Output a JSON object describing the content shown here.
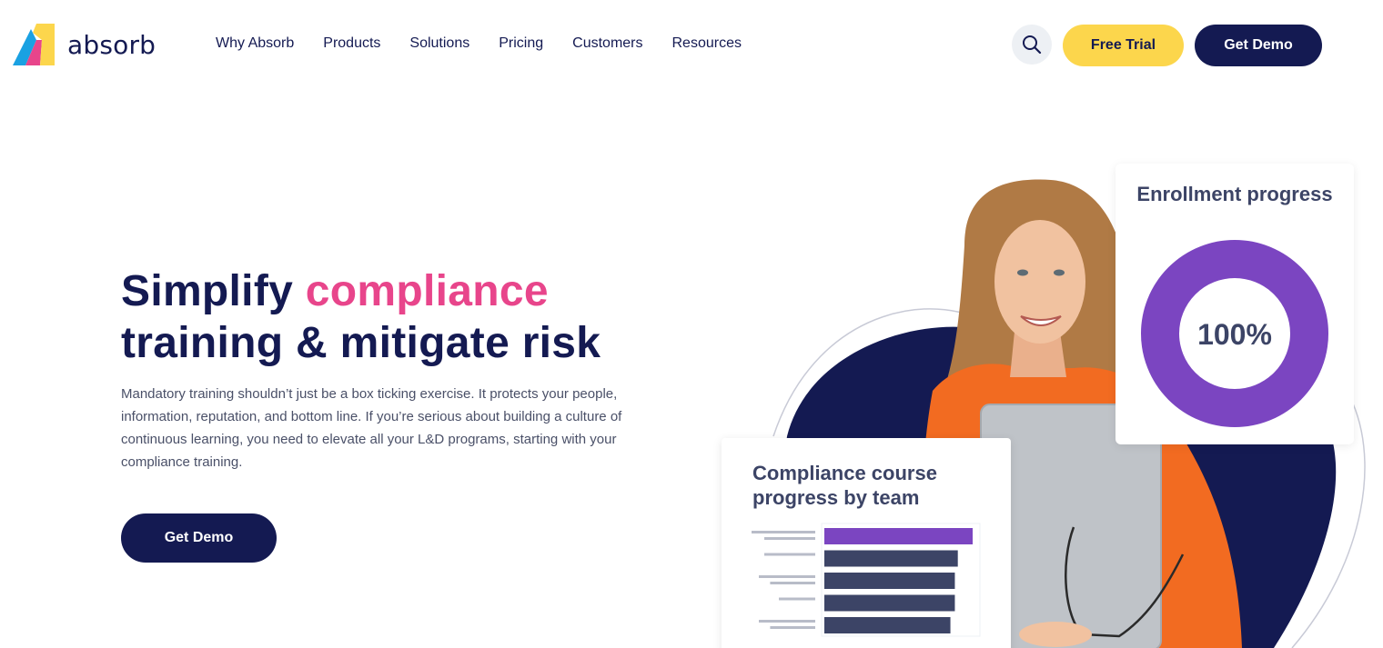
{
  "brand": {
    "name": "absorb",
    "colors": {
      "navy": "#141a52",
      "pink": "#e8458b",
      "yellow": "#fcd64c",
      "purple": "#7b45c1",
      "blue": "#1aa1e2"
    }
  },
  "nav": {
    "items": [
      {
        "label": "Why Absorb"
      },
      {
        "label": "Products"
      },
      {
        "label": "Solutions"
      },
      {
        "label": "Pricing"
      },
      {
        "label": "Customers"
      },
      {
        "label": "Resources"
      }
    ],
    "search_icon": "search-icon",
    "free_trial_label": "Free Trial",
    "get_demo_label": "Get Demo"
  },
  "hero": {
    "title_part1": "Simplify ",
    "title_accent": "compliance",
    "title_part2": "training & mitigate risk",
    "description": "Mandatory training shouldn’t just be a box ticking exercise. It protects your people, information, reputation, and bottom line. If you’re serious about building a culture of continuous learning, you need to elevate all your L&D programs, starting with your compliance training.",
    "cta_label": "Get Demo"
  },
  "enrollment_card": {
    "title": "Enrollment progress",
    "value_label": "100%",
    "progress_fraction": 1.0
  },
  "course_card": {
    "title": "Compliance course progress by team",
    "bars": [
      {
        "value": 1.0,
        "color": "#7b45c1"
      },
      {
        "value": 0.9,
        "color": "#3c4466"
      },
      {
        "value": 0.88,
        "color": "#3c4466"
      },
      {
        "value": 0.88,
        "color": "#3c4466"
      },
      {
        "value": 0.85,
        "color": "#3c4466"
      }
    ]
  }
}
